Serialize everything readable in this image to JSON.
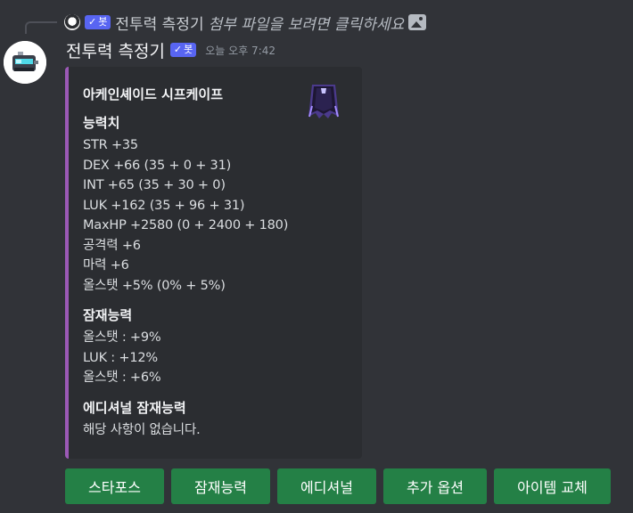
{
  "reply": {
    "author": "전투력 측정기",
    "bot_label": "봇",
    "preview": "첨부 파일을 보려면 클릭하세요"
  },
  "message": {
    "username": "전투력 측정기",
    "bot_label": "봇",
    "timestamp": "오늘 오후 7:42"
  },
  "embed": {
    "accent": "#9b59b6",
    "title": "아케인셰이드 시프케이프",
    "stats": {
      "name": "능력치",
      "lines": [
        "STR +35",
        "DEX +66 (35 + 0 + 31)",
        "INT +65 (35 + 30 + 0)",
        "LUK +162 (35 + 96 + 31)",
        "MaxHP +2580 (0 + 2400 + 180)",
        "공격력 +6",
        "마력 +6",
        "올스탯 +5% (0% + 5%)"
      ]
    },
    "potential": {
      "name": "잠재능력",
      "lines": [
        "올스탯 : +9%",
        "LUK : +12%",
        "올스탯 : +6%"
      ]
    },
    "additional": {
      "name": "에디셔널 잠재능력",
      "value": "해당 사항이 없습니다."
    }
  },
  "buttons": [
    "스타포스",
    "잠재능력",
    "에디셔널",
    "추가 옵션",
    "아이템 교체"
  ],
  "colors": {
    "background": "#313338",
    "embed_bg": "#2b2d31",
    "button": "#248046",
    "bot_tag": "#5865f2"
  }
}
